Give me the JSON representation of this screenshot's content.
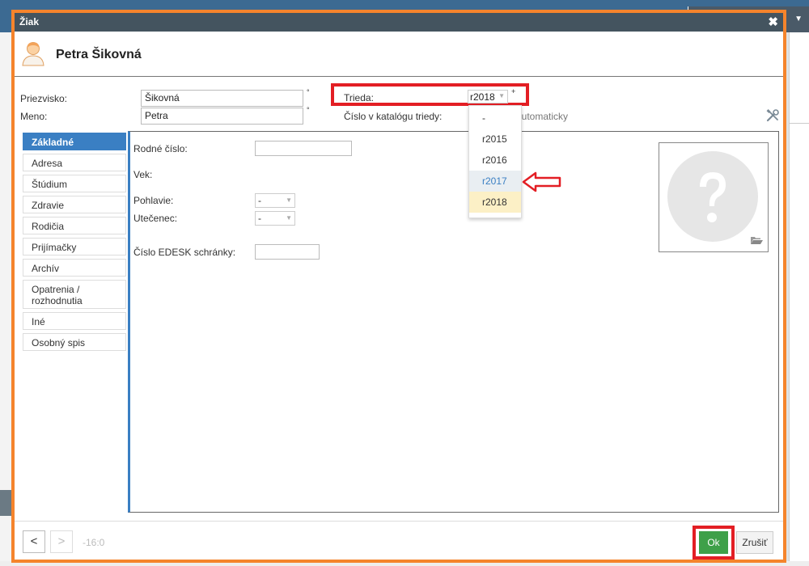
{
  "dialog": {
    "title": "Žiak",
    "close_symbol": "✖",
    "student_name": "Petra Šikovná"
  },
  "form": {
    "surname_label": "Priezvisko:",
    "surname_value": "Šikovná",
    "name_label": "Meno:",
    "name_value": "Petra",
    "required_mark": "°",
    "class_label": "Trieda:",
    "class_value": "r2018",
    "class_plus": "+",
    "catalog_label": "Číslo v katalógu triedy:",
    "catalog_value": "automaticky"
  },
  "class_options": [
    "-",
    "r2015",
    "r2016",
    "r2017",
    "r2018"
  ],
  "tabs": [
    "Základné",
    "Adresa",
    "Štúdium",
    "Zdravie",
    "Rodičia",
    "Prijímačky",
    "Archív",
    "Opatrenia / rozhodnutia",
    "Iné",
    "Osobný spis"
  ],
  "basic": {
    "birth_number_label": "Rodné číslo:",
    "age_label": "Vek:",
    "gender_label": "Pohlavie:",
    "gender_value": "-",
    "refugee_label": "Utečenec:",
    "refugee_value": "-",
    "edesk_label": "Číslo EDESK schránky:"
  },
  "footer": {
    "prev": "<",
    "next": ">",
    "counter": "-16:0",
    "ok": "Ok",
    "cancel": "Zrušiť"
  },
  "colors": {
    "titlebar": "#44545f",
    "dialog_border": "#f5842c",
    "highlight": "#e31e24",
    "tab_active": "#3a7fc3",
    "ok_button": "#3ea049"
  }
}
